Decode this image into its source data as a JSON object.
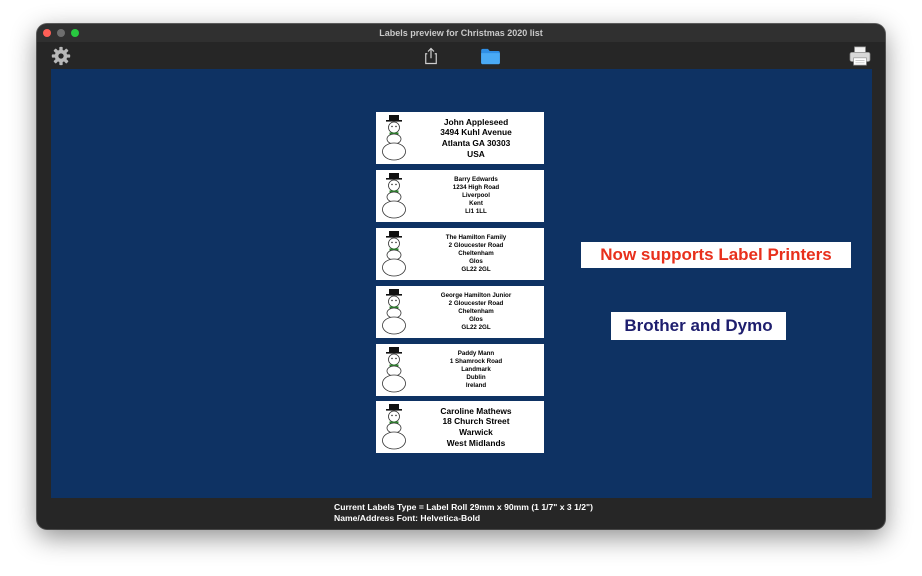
{
  "window": {
    "title": "Labels preview for Christmas 2020 list"
  },
  "toolbar": {
    "settings_icon": "gear-icon",
    "share_icon": "share-icon",
    "folder_icon": "folder-icon",
    "print_icon": "printer-icon"
  },
  "labels": [
    {
      "lines": [
        "John Appleseed",
        "3494 Kuhl Avenue",
        "Atlanta GA 30303",
        "USA"
      ]
    },
    {
      "lines": [
        "Barry Edwards",
        "1234 High Road",
        "Liverpool",
        "Kent",
        "Ll1 1LL"
      ]
    },
    {
      "lines": [
        "The Hamilton Family",
        "2 Gloucester Road",
        "Cheltenham",
        "Glos",
        "GL22 2GL"
      ]
    },
    {
      "lines": [
        "George Hamilton Junior",
        "2 Gloucester Road",
        "Cheltenham",
        "Glos",
        "GL22 2GL"
      ]
    },
    {
      "lines": [
        "Paddy Mann",
        "1 Shamrock Road",
        "Landmark",
        "Dublin",
        "Ireland"
      ]
    },
    {
      "lines": [
        "Caroline Mathews",
        "18 Church Street",
        "Warwick",
        "West Midlands"
      ]
    }
  ],
  "promo": {
    "line1": "Now supports Label Printers",
    "line2": "Brother and Dymo"
  },
  "status": {
    "labels_type": "Current Labels Type = Label Roll 29mm x 90mm (1 1/7\" x 3 1/2\")",
    "font": "Name/Address Font: Helvetica-Bold"
  },
  "colors": {
    "canvas": "#0e3263",
    "promo_red": "#e8301c",
    "promo_blue": "#1e1e6e"
  }
}
